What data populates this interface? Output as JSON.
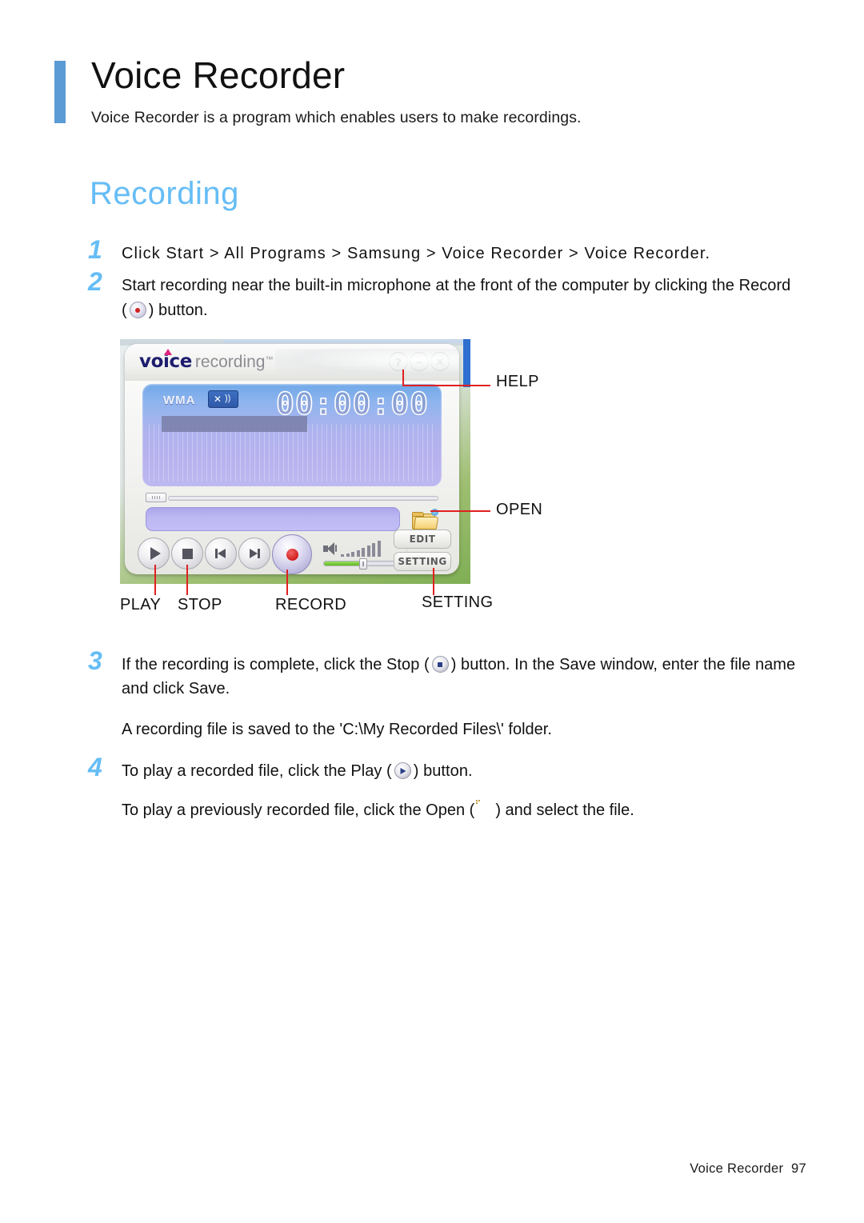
{
  "page": {
    "title": "Voice Recorder",
    "subtitle": "Voice Recorder is a program which enables users to make recordings.",
    "accent_color": "#5b9bd5",
    "heading_color": "#66bdf5",
    "footer_label": "Voice Recorder",
    "footer_page_number": "97"
  },
  "section": {
    "heading": "Recording"
  },
  "steps": [
    {
      "number": "1",
      "text": "Click Start > All Programs > Samsung > Voice Recorder > Voice Recorder."
    },
    {
      "number": "2",
      "text_before": "Start recording near the built-in microphone at the front of the computer by clicking the Record",
      "paren_open": "(",
      "paren_close": ") button.",
      "icon": "record-button-icon"
    },
    {
      "number": "3",
      "text_a": "If the recording is complete, click the Stop (",
      "text_b": ") button. In the Save window, enter the file name and click Save.",
      "icon": "stop-button-icon",
      "note": "A recording file is saved to the 'C:\\My Recorded Files\\' folder."
    },
    {
      "number": "4",
      "text_a": "To play a recorded file, click the Play (",
      "text_b": ") button.",
      "icon": "play-button-icon",
      "note_a": "To play a previously recorded file, click the Open (",
      "note_b": ") and select the file.",
      "note_icon": "open-folder-icon"
    }
  ],
  "app": {
    "logo": {
      "word_primary": "voice",
      "word_secondary": "recording",
      "trademark": "™",
      "primary_color": "#1d1d6e",
      "secondary_color": "#8d8d93",
      "accent_color": "#e0237f"
    },
    "window_buttons": [
      {
        "name": "help-button",
        "glyph": "?"
      },
      {
        "name": "minimize-button",
        "glyph": "–"
      },
      {
        "name": "close-button",
        "glyph": "✕"
      }
    ],
    "display": {
      "format_label": "WMA",
      "mute_icon": "mute-speaker-icon",
      "mute_glyph": "✕",
      "mute_waves": "))",
      "timer": "00:00:00"
    },
    "file_field_value": "",
    "open_button": "open-folder-icon",
    "transport": [
      {
        "name": "play-button",
        "icon": "play-icon"
      },
      {
        "name": "stop-button",
        "icon": "stop-icon"
      },
      {
        "name": "previous-button",
        "icon": "skip-back-icon"
      },
      {
        "name": "next-button",
        "icon": "skip-forward-icon"
      },
      {
        "name": "record-button",
        "icon": "record-icon"
      }
    ],
    "volume": {
      "icon": "speaker-icon",
      "level_bars": [
        3,
        4,
        6,
        8,
        11,
        14,
        17,
        20
      ],
      "slider_percent": 50
    },
    "side_buttons": [
      {
        "name": "edit-button",
        "label": "EDIT"
      },
      {
        "name": "setting-button",
        "label": "SETTING"
      }
    ]
  },
  "callouts": [
    {
      "name": "callout-help",
      "label": "HELP"
    },
    {
      "name": "callout-open",
      "label": "OPEN"
    },
    {
      "name": "callout-play",
      "label": "PLAY"
    },
    {
      "name": "callout-stop",
      "label": "STOP"
    },
    {
      "name": "callout-record",
      "label": "RECORD"
    },
    {
      "name": "callout-setting",
      "label": "SETTING"
    }
  ]
}
